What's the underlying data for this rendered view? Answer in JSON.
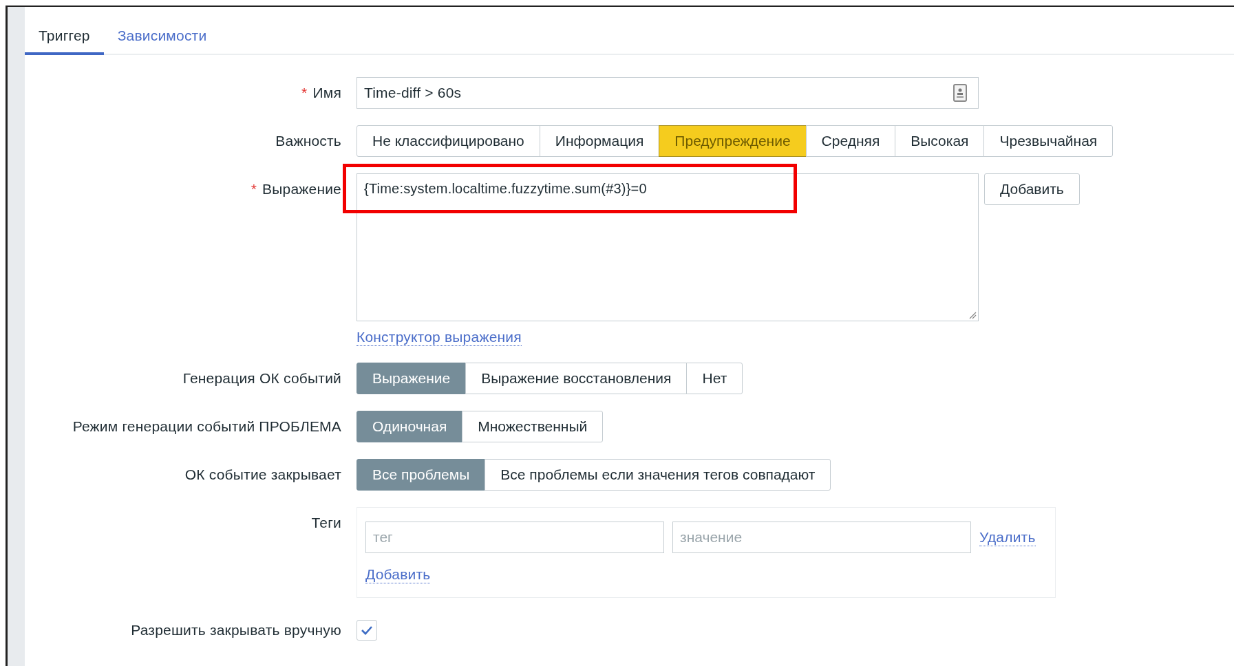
{
  "tabs": [
    {
      "label": "Триггер",
      "selected": true
    },
    {
      "label": "Зависимости",
      "selected": false
    }
  ],
  "form": {
    "name": {
      "required_mark": "*",
      "label": "Имя",
      "value": "Time-diff > 60s"
    },
    "severity": {
      "label": "Важность",
      "options": [
        {
          "label": "Не классифицировано",
          "selected": false
        },
        {
          "label": "Информация",
          "selected": false
        },
        {
          "label": "Предупреждение",
          "selected": true
        },
        {
          "label": "Средняя",
          "selected": false
        },
        {
          "label": "Высокая",
          "selected": false
        },
        {
          "label": "Чрезвычайная",
          "selected": false
        }
      ]
    },
    "expression": {
      "required_mark": "*",
      "label": "Выражение",
      "value": "{Time:system.localtime.fuzzytime.sum(#3)}=0",
      "add_button": "Добавить",
      "builder_link": "Конструктор выражения"
    },
    "ok_event_generation": {
      "label": "Генерация ОК событий",
      "options": [
        {
          "label": "Выражение",
          "selected": true
        },
        {
          "label": "Выражение восстановления",
          "selected": false
        },
        {
          "label": "Нет",
          "selected": false
        }
      ]
    },
    "problem_mode": {
      "label": "Режим генерации событий ПРОБЛЕМА",
      "options": [
        {
          "label": "Одиночная",
          "selected": true
        },
        {
          "label": "Множественный",
          "selected": false
        }
      ]
    },
    "ok_closes": {
      "label": "ОК событие закрывает",
      "options": [
        {
          "label": "Все проблемы",
          "selected": true
        },
        {
          "label": "Все проблемы если значения тегов совпадают",
          "selected": false
        }
      ]
    },
    "tags": {
      "label": "Теги",
      "rows": [
        {
          "tag_placeholder": "тег",
          "value_placeholder": "значение",
          "remove_link": "Удалить"
        }
      ],
      "add_link": "Добавить"
    },
    "manual_close": {
      "label": "Разрешить закрывать вручную",
      "checked": true
    }
  }
}
